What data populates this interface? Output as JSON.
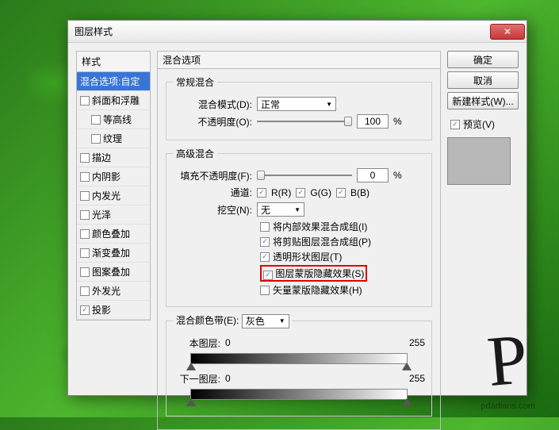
{
  "dialog": {
    "title": "图层样式"
  },
  "left": {
    "header": "样式",
    "items": [
      {
        "label": "混合选项:自定",
        "selected": true,
        "checkbox": false
      },
      {
        "label": "斜面和浮雕",
        "checked": false,
        "checkbox": true
      },
      {
        "label": "等高线",
        "checked": false,
        "checkbox": true,
        "indent": true
      },
      {
        "label": "纹理",
        "checked": false,
        "checkbox": true,
        "indent": true
      },
      {
        "label": "描边",
        "checked": false,
        "checkbox": true
      },
      {
        "label": "内阴影",
        "checked": false,
        "checkbox": true
      },
      {
        "label": "内发光",
        "checked": false,
        "checkbox": true
      },
      {
        "label": "光泽",
        "checked": false,
        "checkbox": true
      },
      {
        "label": "颜色叠加",
        "checked": false,
        "checkbox": true
      },
      {
        "label": "渐变叠加",
        "checked": false,
        "checkbox": true
      },
      {
        "label": "图案叠加",
        "checked": false,
        "checkbox": true
      },
      {
        "label": "外发光",
        "checked": false,
        "checkbox": true
      },
      {
        "label": "投影",
        "checked": true,
        "checkbox": true
      }
    ]
  },
  "mid": {
    "header": "混合选项",
    "general": {
      "legend": "常规混合",
      "mode_label": "混合模式(D):",
      "mode_value": "正常",
      "opacity_label": "不透明度(O):",
      "opacity_value": "100",
      "percent": "%"
    },
    "advanced": {
      "legend": "高级混合",
      "fill_label": "填充不透明度(F):",
      "fill_value": "0",
      "percent": "%",
      "channels_label": "通道:",
      "ch_r": "R(R)",
      "ch_g": "G(G)",
      "ch_b": "B(B)",
      "knockout_label": "挖空(N):",
      "knockout_value": "无",
      "opt1": "将内部效果混合成组(I)",
      "opt2": "将剪贴图层混合成组(P)",
      "opt3": "透明形状图层(T)",
      "opt4": "图层蒙版隐藏效果(S)",
      "opt5": "矢量蒙版隐藏效果(H)"
    },
    "blendif": {
      "legend": "混合颜色带(E):",
      "gray": "灰色",
      "this_label": "本图层:",
      "this_low": "0",
      "this_high": "255",
      "under_label": "下一图层:",
      "under_low": "0",
      "under_high": "255"
    }
  },
  "right": {
    "ok": "确定",
    "cancel": "取消",
    "newstyle": "新建样式(W)...",
    "preview": "预览(V)"
  },
  "watermark": "pdadians.com"
}
